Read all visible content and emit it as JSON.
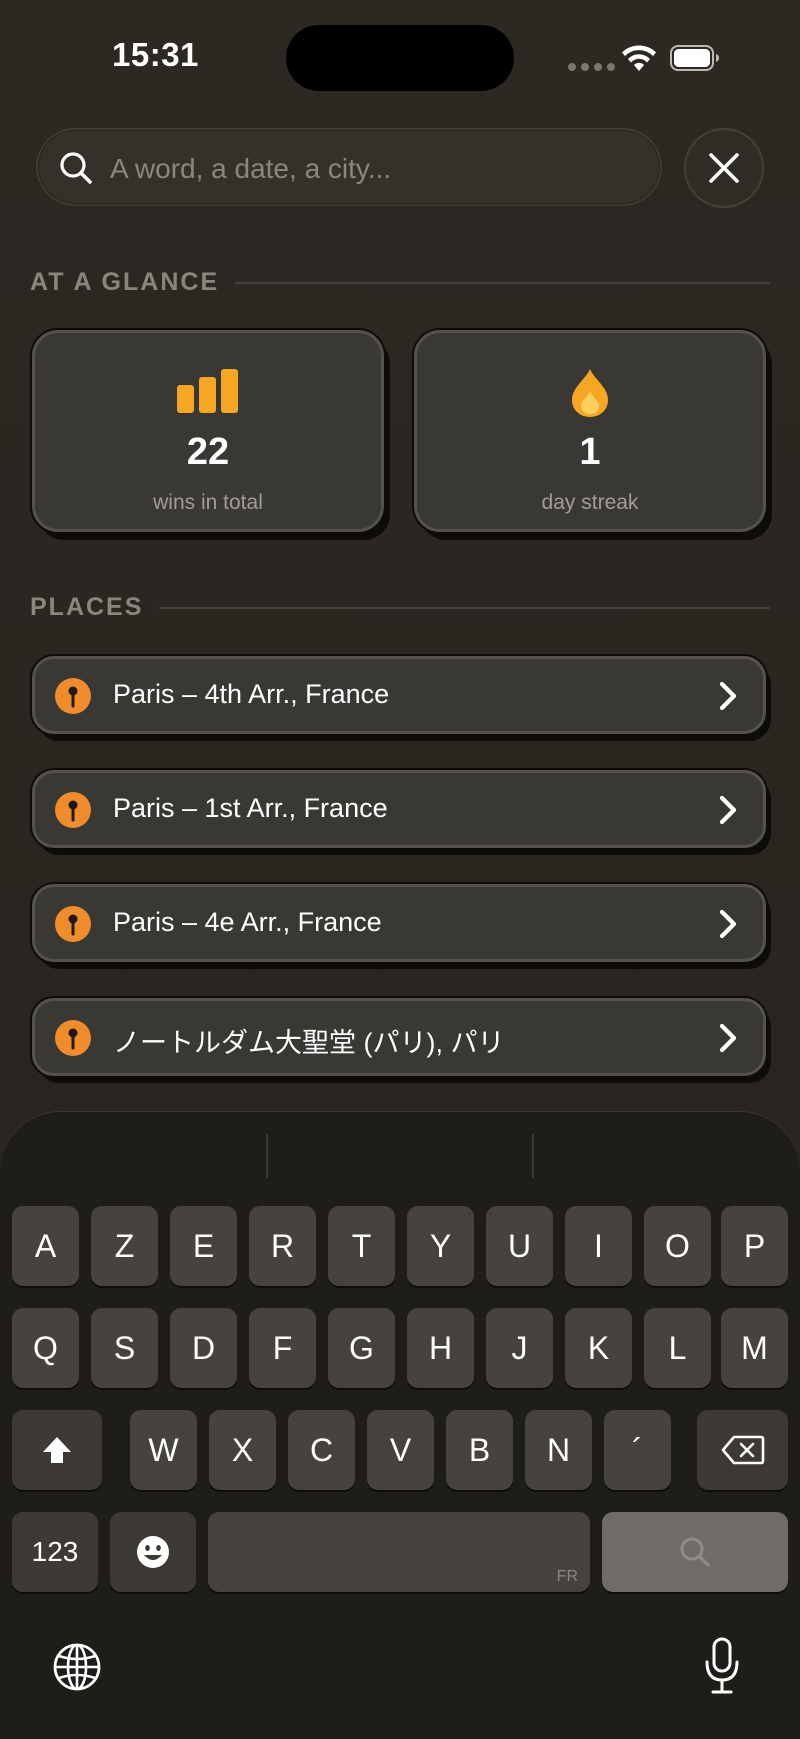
{
  "status_bar": {
    "time": "15:31"
  },
  "search": {
    "placeholder": "A word, a date, a city..."
  },
  "at_a_glance": {
    "heading": "AT A GLANCE",
    "stats": [
      {
        "icon": "bar-chart-icon",
        "value": "22",
        "caption": "wins in total",
        "color": "#f5a623"
      },
      {
        "icon": "flame-icon",
        "value": "1",
        "caption": "day streak",
        "color": "#f5a623"
      }
    ]
  },
  "places": {
    "heading": "PLACES",
    "items": [
      {
        "name": "Paris – 4th Arr., France"
      },
      {
        "name": "Paris – 1st Arr., France"
      },
      {
        "name": "Paris – 4e Arr., France"
      },
      {
        "name": "ノートルダム大聖堂 (パリ), パリ"
      }
    ]
  },
  "keyboard": {
    "row1": [
      "A",
      "Z",
      "E",
      "R",
      "T",
      "Y",
      "U",
      "I",
      "O",
      "P"
    ],
    "row2": [
      "Q",
      "S",
      "D",
      "F",
      "G",
      "H",
      "J",
      "K",
      "L",
      "M"
    ],
    "row3": [
      "W",
      "X",
      "C",
      "V",
      "B",
      "N",
      "´"
    ],
    "numbers_label": "123",
    "space_language": "FR"
  },
  "colors": {
    "accent": "#f08d2a",
    "background": "#2a2620"
  }
}
